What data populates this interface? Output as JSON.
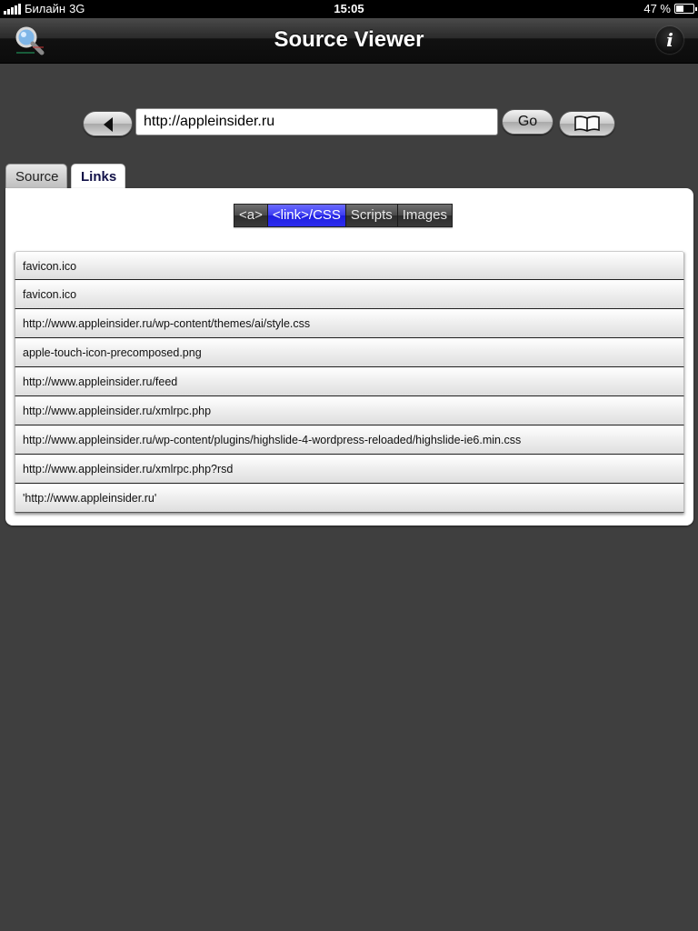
{
  "status": {
    "carrier": "Билайн",
    "network": "3G",
    "time": "15:05",
    "battery": "47 %",
    "battery_level": 0.47,
    "signal_bars": 5
  },
  "navbar": {
    "title": "Source Viewer",
    "logo_icon": "magnifier-app-icon",
    "info_label": "i"
  },
  "url_bar": {
    "value": "http://appleinsider.ru",
    "go_label": "Go",
    "back_icon": "back-arrow-icon",
    "bookmarks_icon": "open-book-icon"
  },
  "tabs": [
    {
      "label": "Source",
      "active": false
    },
    {
      "label": "Links",
      "active": true
    }
  ],
  "segments": [
    {
      "label": "<a>",
      "active": false
    },
    {
      "label": "<link>/CSS",
      "active": true
    },
    {
      "label": "Scripts",
      "active": false
    },
    {
      "label": "Images",
      "active": false
    }
  ],
  "links": [
    "favicon.ico",
    "favicon.ico",
    "http://www.appleinsider.ru/wp-content/themes/ai/style.css",
    "apple-touch-icon-precomposed.png",
    "http://www.appleinsider.ru/feed",
    "http://www.appleinsider.ru/xmlrpc.php",
    "http://www.appleinsider.ru/wp-content/plugins/highslide-4-wordpress-reloaded/highslide-ie6.min.css",
    "http://www.appleinsider.ru/xmlrpc.php?rsd",
    "'http://www.appleinsider.ru'"
  ],
  "colors": {
    "background": "#3f3f3f",
    "segment_active": "#2d2dee",
    "tab_active_text": "#111148"
  }
}
